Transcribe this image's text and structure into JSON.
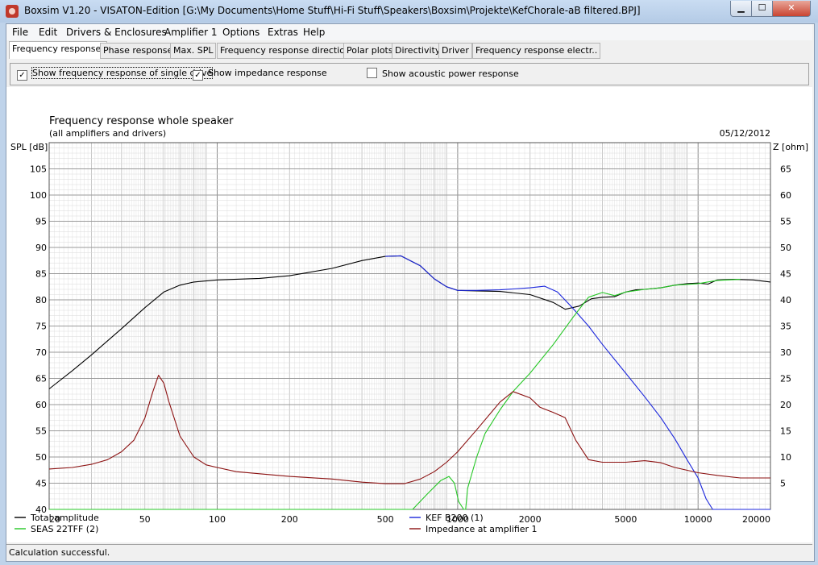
{
  "window": {
    "title": "Boxsim V1.20 - VISATON-Edition [G:\\My Documents\\Home Stuff\\Hi-Fi Stuff\\Speakers\\Boxsim\\Projekte\\KefChorale-aB filtered.BPJ]",
    "minimize": "▁",
    "maximize": "☐",
    "close": "✕",
    "icon": "app-icon"
  },
  "menu": [
    "File",
    "Edit",
    "Drivers & Enclosures",
    "Amplifier 1",
    "Options",
    "Extras",
    "Help"
  ],
  "tabs": [
    "Frequency response.",
    "Phase response",
    "Max. SPL",
    "Frequency response directions",
    "Polar plots",
    "Directivity",
    "Driver",
    "Frequency response electr.."
  ],
  "options": {
    "single_drive": {
      "label": "Show frequency response of single drive",
      "checked": true
    },
    "impedance": {
      "label": "Show impedance response",
      "checked": true
    },
    "acoustic_power": {
      "label": "Show acoustic power response",
      "checked": false
    }
  },
  "status": "Calculation successful.",
  "chart_data": {
    "type": "line",
    "title": "Frequency response whole speaker",
    "subtitle": "(all amplifiers and drivers)",
    "date": "05/12/2012",
    "ylabel": "SPL [dB]",
    "y2label": "Z [ohm]",
    "xscale": "log",
    "xlim": [
      20,
      20000
    ],
    "ylim": [
      40,
      110
    ],
    "y2lim": [
      0,
      70
    ],
    "x_ticks": [
      20,
      50,
      100,
      200,
      500,
      1000,
      2000,
      5000,
      10000,
      20000
    ],
    "y_ticks": [
      40,
      45,
      50,
      55,
      60,
      65,
      70,
      75,
      80,
      85,
      90,
      95,
      100,
      105
    ],
    "y2_ticks": [
      5,
      10,
      15,
      20,
      25,
      30,
      35,
      40,
      45,
      50,
      55,
      60,
      65
    ],
    "grid": true,
    "series": [
      {
        "name": "Total amplitude",
        "color": "#000000",
        "axis": "left",
        "x": [
          20,
          25,
          30,
          40,
          50,
          60,
          70,
          80,
          100,
          150,
          200,
          300,
          400,
          500,
          580,
          700,
          800,
          900,
          1000,
          1200,
          1500,
          2000,
          2500,
          2800,
          3200,
          3600,
          4000,
          4500,
          5000,
          5500,
          6000,
          7000,
          8000,
          9000,
          10000,
          11000,
          12000,
          14000,
          17000,
          20000
        ],
        "y": [
          63,
          66.5,
          69.5,
          74.5,
          78.5,
          81.5,
          82.8,
          83.4,
          83.8,
          84.1,
          84.6,
          86,
          87.5,
          88.3,
          88.4,
          86.5,
          84,
          82.5,
          81.8,
          81.7,
          81.6,
          81,
          79.5,
          78.2,
          78.8,
          80.2,
          80.5,
          80.6,
          81.5,
          81.9,
          82,
          82.3,
          82.8,
          83.1,
          83.2,
          83,
          83.8,
          83.9,
          83.8,
          83.4
        ]
      },
      {
        "name": "KEF B200 (1)",
        "color": "#1c27dc",
        "axis": "left",
        "x": [
          500,
          580,
          700,
          800,
          900,
          1000,
          1200,
          1500,
          2000,
          2300,
          2600,
          3000,
          3500,
          4000,
          5000,
          6000,
          7000,
          8000,
          9000,
          10000,
          10800,
          11500,
          20000
        ],
        "y": [
          88.3,
          88.4,
          86.5,
          84,
          82.5,
          81.8,
          81.8,
          81.9,
          82.3,
          82.6,
          81.5,
          78.5,
          75,
          71.5,
          66,
          61.5,
          57.5,
          53.5,
          49.5,
          46,
          42,
          40,
          40
        ]
      },
      {
        "name": "SEAS 22TFF (2)",
        "color": "#25c725",
        "axis": "left",
        "x": [
          20,
          650,
          750,
          850,
          920,
          970,
          1010,
          1060,
          1080,
          1100,
          1200,
          1300,
          1500,
          1700,
          2000,
          2500,
          3000,
          3500,
          4000,
          4500,
          5000,
          6000,
          7000,
          8000,
          10000,
          12000,
          15000
        ],
        "y": [
          40,
          40,
          43,
          45.5,
          46.3,
          45,
          41.5,
          40,
          40,
          44,
          50,
          54.5,
          59,
          62.5,
          66,
          71.5,
          76.5,
          80.5,
          81.4,
          80.8,
          81.5,
          82,
          82.3,
          82.8,
          83.1,
          83.7,
          83.9
        ]
      },
      {
        "name": "Impedance at amplifier 1",
        "color": "#8b1010",
        "axis": "right",
        "x": [
          20,
          25,
          30,
          35,
          40,
          45,
          50,
          54,
          57,
          60,
          63,
          70,
          80,
          90,
          100,
          120,
          150,
          200,
          300,
          400,
          500,
          600,
          700,
          800,
          900,
          1000,
          1200,
          1500,
          1700,
          2000,
          2200,
          2500,
          2800,
          3100,
          3500,
          4000,
          5000,
          6000,
          7000,
          8000,
          10000,
          12000,
          15000,
          20000
        ],
        "y": [
          7.7,
          8,
          8.6,
          9.5,
          11,
          13.2,
          17.4,
          22.5,
          25.6,
          24.1,
          20.5,
          14,
          10,
          8.5,
          8,
          7.2,
          6.8,
          6.3,
          5.8,
          5.2,
          4.9,
          4.9,
          5.8,
          7.2,
          9,
          11,
          15.2,
          20.5,
          22.5,
          21.3,
          19.5,
          18.5,
          17.5,
          13.2,
          9.5,
          9,
          9,
          9.3,
          8.9,
          8,
          7,
          6.5,
          6,
          6
        ]
      }
    ]
  }
}
